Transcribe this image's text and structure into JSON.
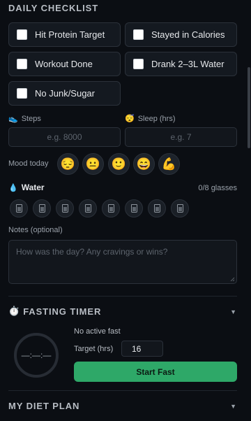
{
  "checklist": {
    "title": "DAILY CHECKLIST",
    "items": [
      {
        "label": "Hit Protein Target",
        "checked": false
      },
      {
        "label": "Stayed in Calories",
        "checked": false
      },
      {
        "label": "Workout Done",
        "checked": false
      },
      {
        "label": "Drank 2–3L Water",
        "checked": false
      },
      {
        "label": "No Junk/Sugar",
        "checked": false
      }
    ]
  },
  "steps": {
    "label": "Steps",
    "icon": "shoe-icon",
    "placeholder": "e.g. 8000"
  },
  "sleep": {
    "label": "Sleep (hrs)",
    "icon": "sleepy-face-icon",
    "placeholder": "e.g. 7"
  },
  "mood": {
    "label": "Mood today",
    "options": [
      "😔",
      "😐",
      "🙂",
      "😄",
      "💪"
    ]
  },
  "water": {
    "label": "Water",
    "icon": "droplet-icon",
    "count_text": "0/8 glasses",
    "filled": 0,
    "total": 8
  },
  "notes": {
    "label": "Notes (optional)",
    "placeholder": "How was the day? Any cravings or wins?"
  },
  "fasting": {
    "title": "FASTING TIMER",
    "icon": "stopwatch-icon",
    "status": "No active fast",
    "timer_text": "—:—:—",
    "target_label": "Target (hrs)",
    "target_value": "16",
    "start_label": "Start Fast",
    "colors": {
      "accent": "#2ea868"
    }
  },
  "diet_plan": {
    "title": "MY DIET PLAN"
  }
}
